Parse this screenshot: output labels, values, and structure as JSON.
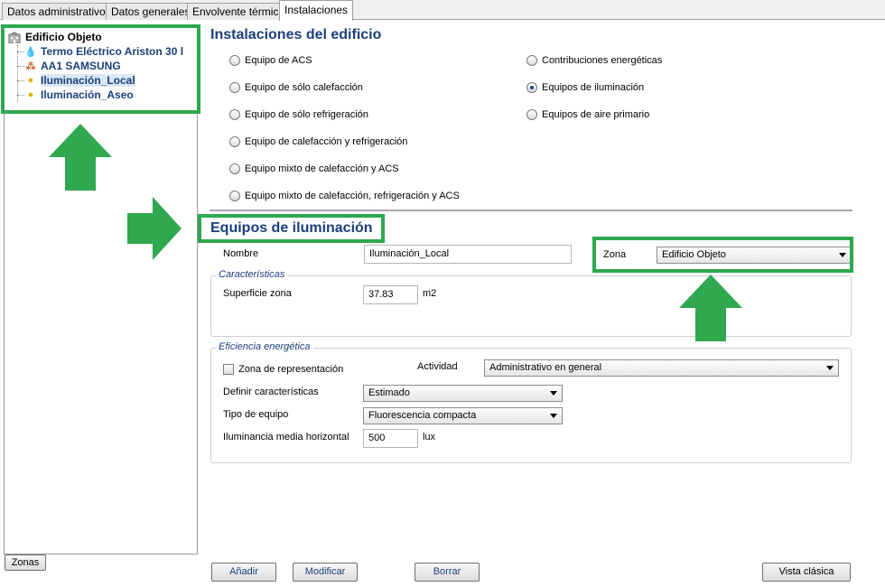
{
  "tabs": [
    {
      "label": "Datos administrativos"
    },
    {
      "label": "Datos generales"
    },
    {
      "label": "Envolvente térmica"
    },
    {
      "label": "Instalaciones"
    }
  ],
  "tree": {
    "root": "Edificio Objeto",
    "items": [
      {
        "label": "Termo Eléctrico Ariston 30 l",
        "icon": "water-drop-icon"
      },
      {
        "label": "AA1 SAMSUNG",
        "icon": "air-conditioner-icon"
      },
      {
        "label": "Iluminación_Local",
        "icon": "light-bulb-icon"
      },
      {
        "label": "Iluminación_Aseo",
        "icon": "light-bulb-icon"
      }
    ]
  },
  "installations": {
    "title": "Instalaciones del edificio",
    "options_left": [
      {
        "label": "Equipo de ACS",
        "selected": false
      },
      {
        "label": "Equipo de sólo calefacción",
        "selected": false
      },
      {
        "label": "Equipo de sólo refrigeración",
        "selected": false
      },
      {
        "label": "Equipo de calefacción y refrigeración",
        "selected": false
      },
      {
        "label": "Equipo mixto de calefacción y ACS",
        "selected": false
      },
      {
        "label": "Equipo mixto de calefacción, refrigeración y ACS",
        "selected": false
      }
    ],
    "options_right": [
      {
        "label": "Contribuciones energéticas",
        "selected": false
      },
      {
        "label": "Equipos de iluminación",
        "selected": true
      },
      {
        "label": "Equipos de aire primario",
        "selected": false
      }
    ]
  },
  "equipment": {
    "title": "Equipos de iluminación",
    "name_label": "Nombre",
    "name_value": "Iluminación_Local",
    "zone_label": "Zona",
    "zone_value": "Edificio Objeto",
    "characteristics": {
      "legend": "Características",
      "surface_label": "Superficie zona",
      "surface_value": "37.83",
      "surface_unit": "m2"
    },
    "efficiency": {
      "legend": "Eficiencia energética",
      "representative_label": "Zona de representación",
      "representative_checked": false,
      "activity_label": "Actividad",
      "activity_value": "Administrativo en general",
      "define_label": "Definir características",
      "define_value": "Estimado",
      "type_label": "Tipo de equipo",
      "type_value": "Fluorescencia compacta",
      "illuminance_label": "Iluminancia media horizontal",
      "illuminance_value": "500",
      "illuminance_unit": "lux"
    }
  },
  "buttons": {
    "zones": "Zonas",
    "add": "Añadir",
    "modify": "Modificar",
    "delete": "Borrar",
    "classic_view": "Vista clásica"
  },
  "colors": {
    "highlight": "#2fa84f",
    "heading": "#1b3f7a"
  }
}
